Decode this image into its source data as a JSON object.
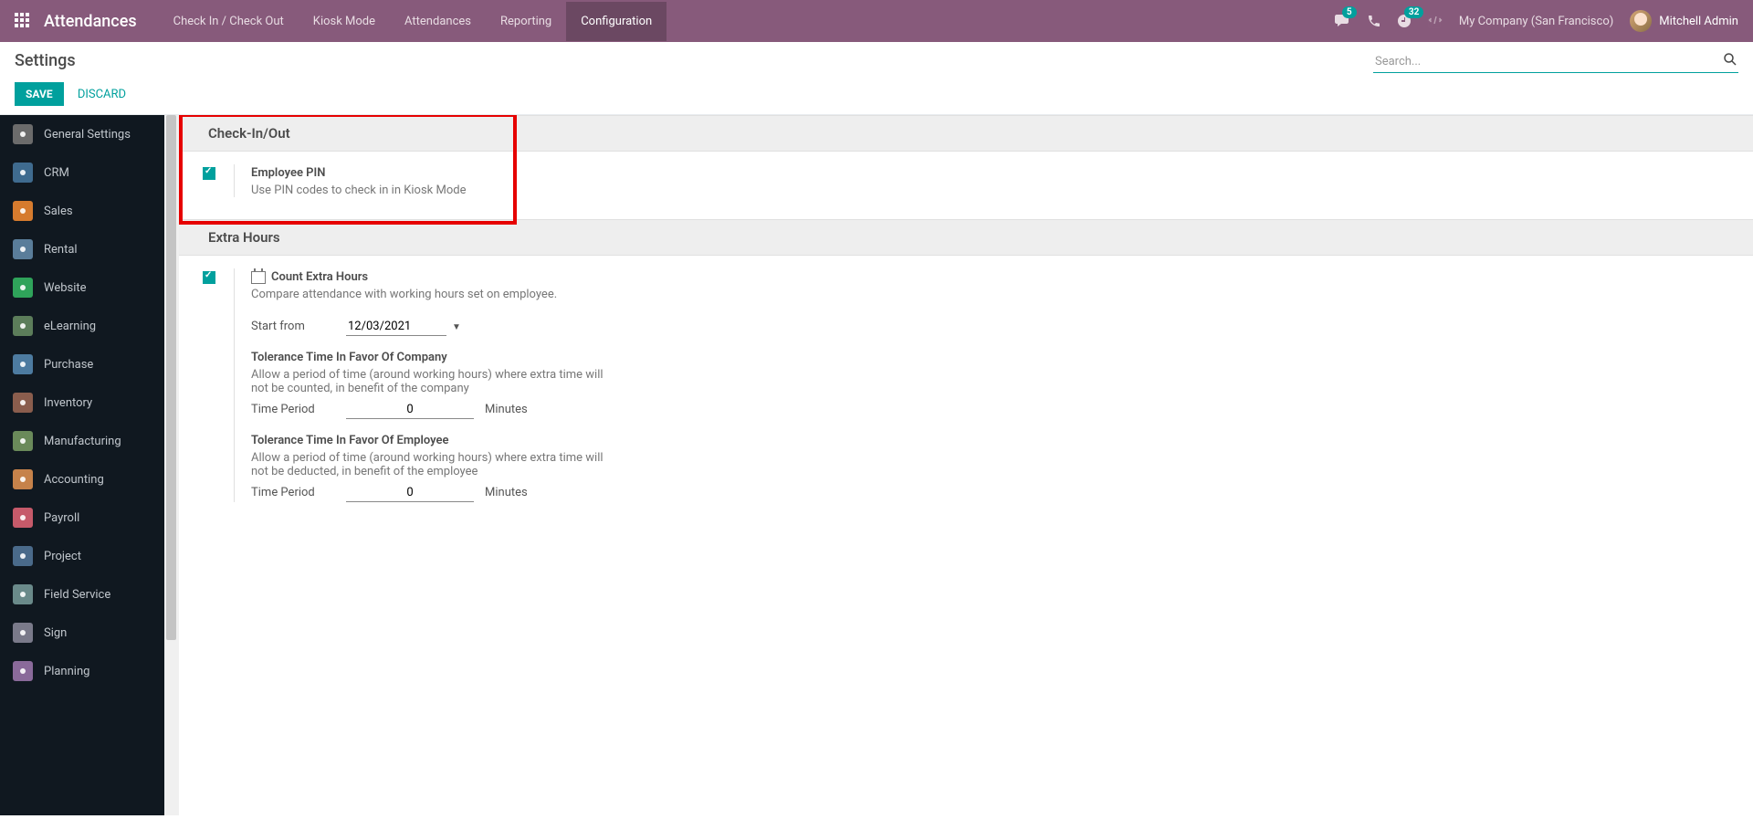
{
  "nav": {
    "brand": "Attendances",
    "menus": [
      "Check In / Check Out",
      "Kiosk Mode",
      "Attendances",
      "Reporting",
      "Configuration"
    ],
    "active_index": 4,
    "conversations_badge": "5",
    "activities_badge": "32",
    "company": "My Company (San Francisco)",
    "user": "Mitchell Admin"
  },
  "control": {
    "title": "Settings",
    "save": "SAVE",
    "discard": "DISCARD",
    "search_placeholder": "Search..."
  },
  "sidebar": {
    "items": [
      {
        "label": "General Settings",
        "color": "#6b6b6b"
      },
      {
        "label": "CRM",
        "color": "#3f6b8f"
      },
      {
        "label": "Sales",
        "color": "#d67b2e"
      },
      {
        "label": "Rental",
        "color": "#5a7d9a"
      },
      {
        "label": "Website",
        "color": "#2fa35a"
      },
      {
        "label": "eLearning",
        "color": "#5c7d5a"
      },
      {
        "label": "Purchase",
        "color": "#4d7ba0"
      },
      {
        "label": "Inventory",
        "color": "#8a5d4d"
      },
      {
        "label": "Manufacturing",
        "color": "#6a8a5a"
      },
      {
        "label": "Accounting",
        "color": "#c6824a"
      },
      {
        "label": "Payroll",
        "color": "#c65a6a"
      },
      {
        "label": "Project",
        "color": "#4a6a8a"
      },
      {
        "label": "Field Service",
        "color": "#6a8a8a"
      },
      {
        "label": "Sign",
        "color": "#7a7a8a"
      },
      {
        "label": "Planning",
        "color": "#8a6a9a"
      }
    ]
  },
  "sections": {
    "checkin": {
      "header": "Check-In/Out",
      "employee_pin": {
        "title": "Employee PIN",
        "desc": "Use PIN codes to check in in Kiosk Mode"
      }
    },
    "extra": {
      "header": "Extra Hours",
      "count": {
        "title": "Count Extra Hours",
        "desc": "Compare attendance with working hours set on employee."
      },
      "start_from_label": "Start from",
      "start_from_value": "12/03/2021",
      "tol_company": {
        "title": "Tolerance Time In Favor Of Company",
        "desc": "Allow a period of time (around working hours) where extra time will not be counted, in benefit of the company",
        "period_label": "Time Period",
        "period_value": "0",
        "unit": "Minutes"
      },
      "tol_employee": {
        "title": "Tolerance Time In Favor Of Employee",
        "desc": "Allow a period of time (around working hours) where extra time will not be deducted, in benefit of the employee",
        "period_label": "Time Period",
        "period_value": "0",
        "unit": "Minutes"
      }
    }
  }
}
